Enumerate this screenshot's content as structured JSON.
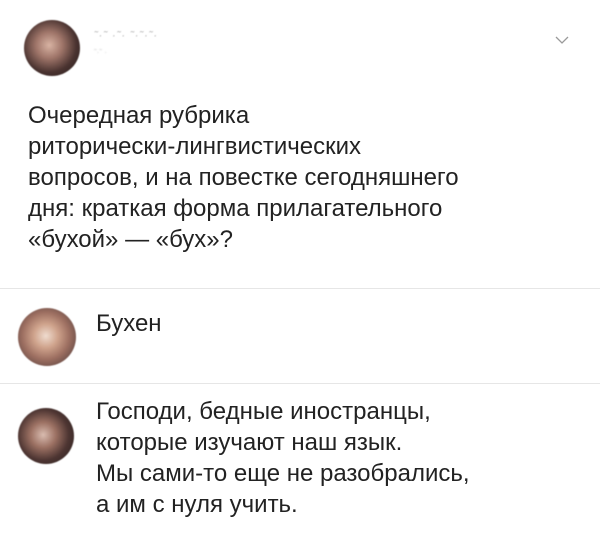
{
  "post": {
    "author": {
      "name": "˜·˜ ·˜· ˜·˜·˜·",
      "meta": "˜·˜ ·"
    },
    "text": "Очередная рубрика\nриторически-лингвистических\nвопросов, и на повестке сегодняшнего\nдня: краткая форма прилагательного\n«бухой» — «бух»?"
  },
  "comments": [
    {
      "text": "Бухен"
    },
    {
      "text": "Господи, бедные иностранцы,\nкоторые изучают наш язык.\nМы сами-то еще не разобрались,\nа им с нуля учить."
    }
  ],
  "icons": {
    "menu": "chevron-down-icon"
  },
  "colors": {
    "text": "#222222",
    "divider": "#e6e6e6",
    "background": "#ffffff"
  }
}
